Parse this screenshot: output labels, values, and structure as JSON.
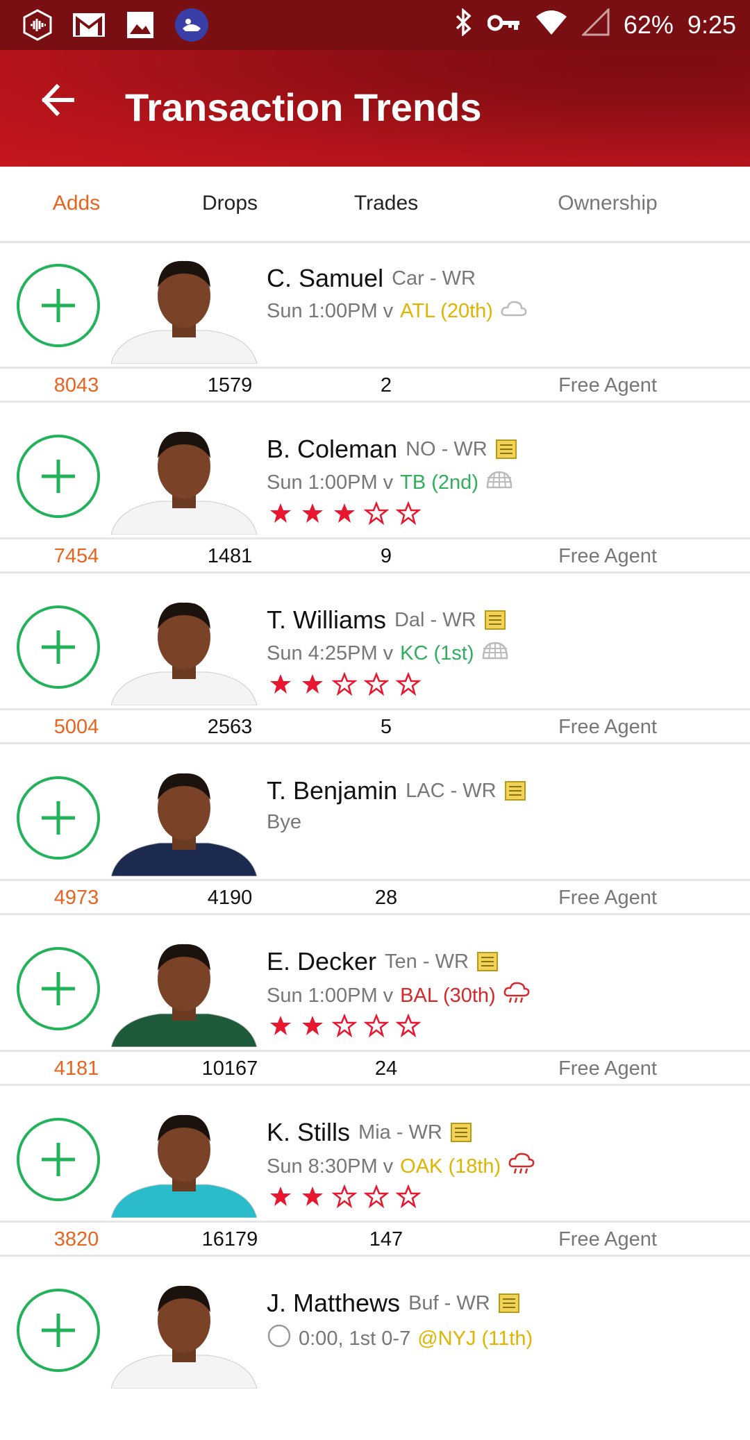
{
  "status_bar": {
    "battery": "62%",
    "time": "9:25"
  },
  "header": {
    "title": "Transaction Trends"
  },
  "tabs": [
    {
      "label": "Adds",
      "state": "active"
    },
    {
      "label": "Drops",
      "state": "normal"
    },
    {
      "label": "Trades",
      "state": "normal"
    },
    {
      "label": "Ownership",
      "state": "muted"
    }
  ],
  "colors": {
    "accent": "#e8641e",
    "add_green": "#22b25a",
    "header_red": "#c7161e",
    "star_red": "#e8162e",
    "opp_yellow": "#e0b400",
    "opp_green": "#2fae5c",
    "opp_red": "#d62828"
  },
  "players": [
    {
      "name": "C. Samuel",
      "team_pos": "Car - WR",
      "has_note": false,
      "game": "Sun 1:00PM v",
      "opponent": "ATL (20th)",
      "opp_color": "yellow",
      "weather_icon": "cloud-icon",
      "stars": 0,
      "adds": "8043",
      "drops": "1579",
      "trades": "2",
      "ownership": "Free Agent",
      "jersey": "white"
    },
    {
      "name": "B. Coleman",
      "team_pos": "NO - WR",
      "has_note": true,
      "game": "Sun 1:00PM v",
      "opponent": "TB (2nd)",
      "opp_color": "green",
      "weather_icon": "dome-icon",
      "stars": 3,
      "adds": "7454",
      "drops": "1481",
      "trades": "9",
      "ownership": "Free Agent",
      "jersey": "white"
    },
    {
      "name": "T. Williams",
      "team_pos": "Dal - WR",
      "has_note": true,
      "game": "Sun 4:25PM v",
      "opponent": "KC (1st)",
      "opp_color": "green",
      "weather_icon": "dome-icon",
      "stars": 2,
      "adds": "5004",
      "drops": "2563",
      "trades": "5",
      "ownership": "Free Agent",
      "jersey": "white"
    },
    {
      "name": "T. Benjamin",
      "team_pos": "LAC - WR",
      "has_note": true,
      "game": "Bye",
      "opponent": "",
      "opp_color": "none",
      "weather_icon": "",
      "stars": 0,
      "adds": "4973",
      "drops": "4190",
      "trades": "28",
      "ownership": "Free Agent",
      "jersey": "navy"
    },
    {
      "name": "E. Decker",
      "team_pos": "Ten - WR",
      "has_note": true,
      "game": "Sun 1:00PM v",
      "opponent": "BAL (30th)",
      "opp_color": "red",
      "weather_icon": "rain-icon",
      "stars": 2,
      "adds": "4181",
      "drops": "10167",
      "trades": "24",
      "ownership": "Free Agent",
      "jersey": "green"
    },
    {
      "name": "K. Stills",
      "team_pos": "Mia - WR",
      "has_note": true,
      "game": "Sun 8:30PM v",
      "opponent": "OAK (18th)",
      "opp_color": "yellow",
      "weather_icon": "rain-icon",
      "stars": 2,
      "adds": "3820",
      "drops": "16179",
      "trades": "147",
      "ownership": "Free Agent",
      "jersey": "teal"
    },
    {
      "name": "J. Matthews",
      "team_pos": "Buf - WR",
      "has_note": true,
      "game": "0:00, 1st 0-7",
      "opponent": "@NYJ (11th)",
      "opp_color": "yellow",
      "weather_icon": "clock-icon",
      "stars": 0,
      "adds": "",
      "drops": "",
      "trades": "",
      "ownership": "",
      "jersey": "white"
    }
  ]
}
